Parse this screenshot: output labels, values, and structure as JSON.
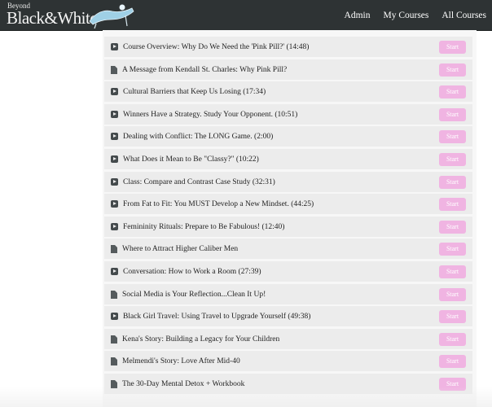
{
  "header": {
    "logo_top": "Beyond",
    "logo_main": "Black&White",
    "nav": [
      "Admin",
      "My Courses",
      "All Courses"
    ]
  },
  "lessons": [
    {
      "type": "video",
      "title": "Course Overview: Why Do We Need the 'Pink Pill?' (14:48)",
      "action": "Start"
    },
    {
      "type": "doc",
      "title": "A Message from Kendall St. Charles: Why Pink Pill?",
      "action": "Start"
    },
    {
      "type": "video",
      "title": "Cultural Barriers that Keep Us Losing (17:34)",
      "action": "Start"
    },
    {
      "type": "video",
      "title": "Winners Have a Strategy. Study Your Opponent. (10:51)",
      "action": "Start"
    },
    {
      "type": "video",
      "title": "Dealing with Conflict: The LONG Game. (2:00)",
      "action": "Start"
    },
    {
      "type": "video",
      "title": "What Does it Mean to Be \"Classy?\" (10:22)",
      "action": "Start"
    },
    {
      "type": "video",
      "title": "Class: Compare and Contrast Case Study (32:31)",
      "action": "Start"
    },
    {
      "type": "video",
      "title": "From Fat to Fit: You MUST Develop a New Mindset. (44:25)",
      "action": "Start"
    },
    {
      "type": "video",
      "title": "Femininity Rituals: Prepare to Be Fabulous! (12:40)",
      "action": "Start"
    },
    {
      "type": "doc",
      "title": "Where to Attract Higher Caliber Men",
      "action": "Start"
    },
    {
      "type": "video",
      "title": "Conversation: How to Work a Room (27:39)",
      "action": "Start"
    },
    {
      "type": "doc",
      "title": "Social Media is Your Reflection...Clean It Up!",
      "action": "Start"
    },
    {
      "type": "video",
      "title": "Black Girl Travel: Using Travel to Upgrade Yourself (49:38)",
      "action": "Start"
    },
    {
      "type": "doc",
      "title": "Kena's Story: Building a Legacy for Your Children",
      "action": "Start"
    },
    {
      "type": "doc",
      "title": "Melmendi's Story: Love After Mid-40",
      "action": "Start"
    },
    {
      "type": "doc",
      "title": "The 30-Day Mental Detox + Workbook",
      "action": "Start"
    }
  ],
  "colors": {
    "header_bg": "#2e3334",
    "row_bg": "#ececec",
    "start_button": "#f0b4e2"
  },
  "icons": {
    "video": "play-icon",
    "doc": "document-icon"
  }
}
